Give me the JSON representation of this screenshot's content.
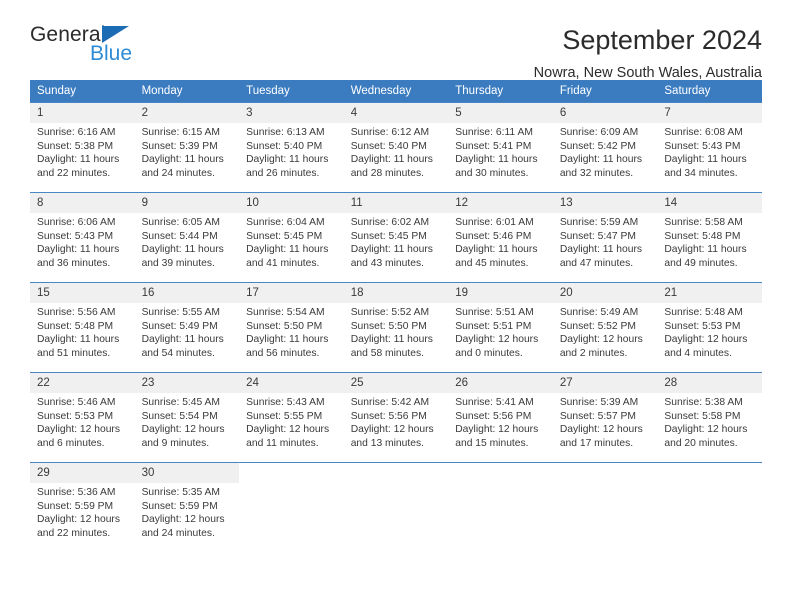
{
  "brand": {
    "name_top": "General",
    "name_bottom": "Blue",
    "triangle_color": "#1c6cb5",
    "blue_text_color": "#2e8bd6"
  },
  "header": {
    "title": "September 2024",
    "subtitle": "Nowra, New South Wales, Australia"
  },
  "theme": {
    "header_bg": "#3b7cc0",
    "header_text": "#ffffff",
    "daynum_bg": "#f0f0f0",
    "grid_line": "#4a86c5",
    "body_text": "#3a3a3a"
  },
  "weekdays": [
    "Sunday",
    "Monday",
    "Tuesday",
    "Wednesday",
    "Thursday",
    "Friday",
    "Saturday"
  ],
  "weeks": [
    [
      {
        "day": "1",
        "sunrise": "Sunrise: 6:16 AM",
        "sunset": "Sunset: 5:38 PM",
        "daylight1": "Daylight: 11 hours",
        "daylight2": "and 22 minutes."
      },
      {
        "day": "2",
        "sunrise": "Sunrise: 6:15 AM",
        "sunset": "Sunset: 5:39 PM",
        "daylight1": "Daylight: 11 hours",
        "daylight2": "and 24 minutes."
      },
      {
        "day": "3",
        "sunrise": "Sunrise: 6:13 AM",
        "sunset": "Sunset: 5:40 PM",
        "daylight1": "Daylight: 11 hours",
        "daylight2": "and 26 minutes."
      },
      {
        "day": "4",
        "sunrise": "Sunrise: 6:12 AM",
        "sunset": "Sunset: 5:40 PM",
        "daylight1": "Daylight: 11 hours",
        "daylight2": "and 28 minutes."
      },
      {
        "day": "5",
        "sunrise": "Sunrise: 6:11 AM",
        "sunset": "Sunset: 5:41 PM",
        "daylight1": "Daylight: 11 hours",
        "daylight2": "and 30 minutes."
      },
      {
        "day": "6",
        "sunrise": "Sunrise: 6:09 AM",
        "sunset": "Sunset: 5:42 PM",
        "daylight1": "Daylight: 11 hours",
        "daylight2": "and 32 minutes."
      },
      {
        "day": "7",
        "sunrise": "Sunrise: 6:08 AM",
        "sunset": "Sunset: 5:43 PM",
        "daylight1": "Daylight: 11 hours",
        "daylight2": "and 34 minutes."
      }
    ],
    [
      {
        "day": "8",
        "sunrise": "Sunrise: 6:06 AM",
        "sunset": "Sunset: 5:43 PM",
        "daylight1": "Daylight: 11 hours",
        "daylight2": "and 36 minutes."
      },
      {
        "day": "9",
        "sunrise": "Sunrise: 6:05 AM",
        "sunset": "Sunset: 5:44 PM",
        "daylight1": "Daylight: 11 hours",
        "daylight2": "and 39 minutes."
      },
      {
        "day": "10",
        "sunrise": "Sunrise: 6:04 AM",
        "sunset": "Sunset: 5:45 PM",
        "daylight1": "Daylight: 11 hours",
        "daylight2": "and 41 minutes."
      },
      {
        "day": "11",
        "sunrise": "Sunrise: 6:02 AM",
        "sunset": "Sunset: 5:45 PM",
        "daylight1": "Daylight: 11 hours",
        "daylight2": "and 43 minutes."
      },
      {
        "day": "12",
        "sunrise": "Sunrise: 6:01 AM",
        "sunset": "Sunset: 5:46 PM",
        "daylight1": "Daylight: 11 hours",
        "daylight2": "and 45 minutes."
      },
      {
        "day": "13",
        "sunrise": "Sunrise: 5:59 AM",
        "sunset": "Sunset: 5:47 PM",
        "daylight1": "Daylight: 11 hours",
        "daylight2": "and 47 minutes."
      },
      {
        "day": "14",
        "sunrise": "Sunrise: 5:58 AM",
        "sunset": "Sunset: 5:48 PM",
        "daylight1": "Daylight: 11 hours",
        "daylight2": "and 49 minutes."
      }
    ],
    [
      {
        "day": "15",
        "sunrise": "Sunrise: 5:56 AM",
        "sunset": "Sunset: 5:48 PM",
        "daylight1": "Daylight: 11 hours",
        "daylight2": "and 51 minutes."
      },
      {
        "day": "16",
        "sunrise": "Sunrise: 5:55 AM",
        "sunset": "Sunset: 5:49 PM",
        "daylight1": "Daylight: 11 hours",
        "daylight2": "and 54 minutes."
      },
      {
        "day": "17",
        "sunrise": "Sunrise: 5:54 AM",
        "sunset": "Sunset: 5:50 PM",
        "daylight1": "Daylight: 11 hours",
        "daylight2": "and 56 minutes."
      },
      {
        "day": "18",
        "sunrise": "Sunrise: 5:52 AM",
        "sunset": "Sunset: 5:50 PM",
        "daylight1": "Daylight: 11 hours",
        "daylight2": "and 58 minutes."
      },
      {
        "day": "19",
        "sunrise": "Sunrise: 5:51 AM",
        "sunset": "Sunset: 5:51 PM",
        "daylight1": "Daylight: 12 hours",
        "daylight2": "and 0 minutes."
      },
      {
        "day": "20",
        "sunrise": "Sunrise: 5:49 AM",
        "sunset": "Sunset: 5:52 PM",
        "daylight1": "Daylight: 12 hours",
        "daylight2": "and 2 minutes."
      },
      {
        "day": "21",
        "sunrise": "Sunrise: 5:48 AM",
        "sunset": "Sunset: 5:53 PM",
        "daylight1": "Daylight: 12 hours",
        "daylight2": "and 4 minutes."
      }
    ],
    [
      {
        "day": "22",
        "sunrise": "Sunrise: 5:46 AM",
        "sunset": "Sunset: 5:53 PM",
        "daylight1": "Daylight: 12 hours",
        "daylight2": "and 6 minutes."
      },
      {
        "day": "23",
        "sunrise": "Sunrise: 5:45 AM",
        "sunset": "Sunset: 5:54 PM",
        "daylight1": "Daylight: 12 hours",
        "daylight2": "and 9 minutes."
      },
      {
        "day": "24",
        "sunrise": "Sunrise: 5:43 AM",
        "sunset": "Sunset: 5:55 PM",
        "daylight1": "Daylight: 12 hours",
        "daylight2": "and 11 minutes."
      },
      {
        "day": "25",
        "sunrise": "Sunrise: 5:42 AM",
        "sunset": "Sunset: 5:56 PM",
        "daylight1": "Daylight: 12 hours",
        "daylight2": "and 13 minutes."
      },
      {
        "day": "26",
        "sunrise": "Sunrise: 5:41 AM",
        "sunset": "Sunset: 5:56 PM",
        "daylight1": "Daylight: 12 hours",
        "daylight2": "and 15 minutes."
      },
      {
        "day": "27",
        "sunrise": "Sunrise: 5:39 AM",
        "sunset": "Sunset: 5:57 PM",
        "daylight1": "Daylight: 12 hours",
        "daylight2": "and 17 minutes."
      },
      {
        "day": "28",
        "sunrise": "Sunrise: 5:38 AM",
        "sunset": "Sunset: 5:58 PM",
        "daylight1": "Daylight: 12 hours",
        "daylight2": "and 20 minutes."
      }
    ],
    [
      {
        "day": "29",
        "sunrise": "Sunrise: 5:36 AM",
        "sunset": "Sunset: 5:59 PM",
        "daylight1": "Daylight: 12 hours",
        "daylight2": "and 22 minutes."
      },
      {
        "day": "30",
        "sunrise": "Sunrise: 5:35 AM",
        "sunset": "Sunset: 5:59 PM",
        "daylight1": "Daylight: 12 hours",
        "daylight2": "and 24 minutes."
      },
      {
        "day": "",
        "sunrise": "",
        "sunset": "",
        "daylight1": "",
        "daylight2": ""
      },
      {
        "day": "",
        "sunrise": "",
        "sunset": "",
        "daylight1": "",
        "daylight2": ""
      },
      {
        "day": "",
        "sunrise": "",
        "sunset": "",
        "daylight1": "",
        "daylight2": ""
      },
      {
        "day": "",
        "sunrise": "",
        "sunset": "",
        "daylight1": "",
        "daylight2": ""
      },
      {
        "day": "",
        "sunrise": "",
        "sunset": "",
        "daylight1": "",
        "daylight2": ""
      }
    ]
  ]
}
